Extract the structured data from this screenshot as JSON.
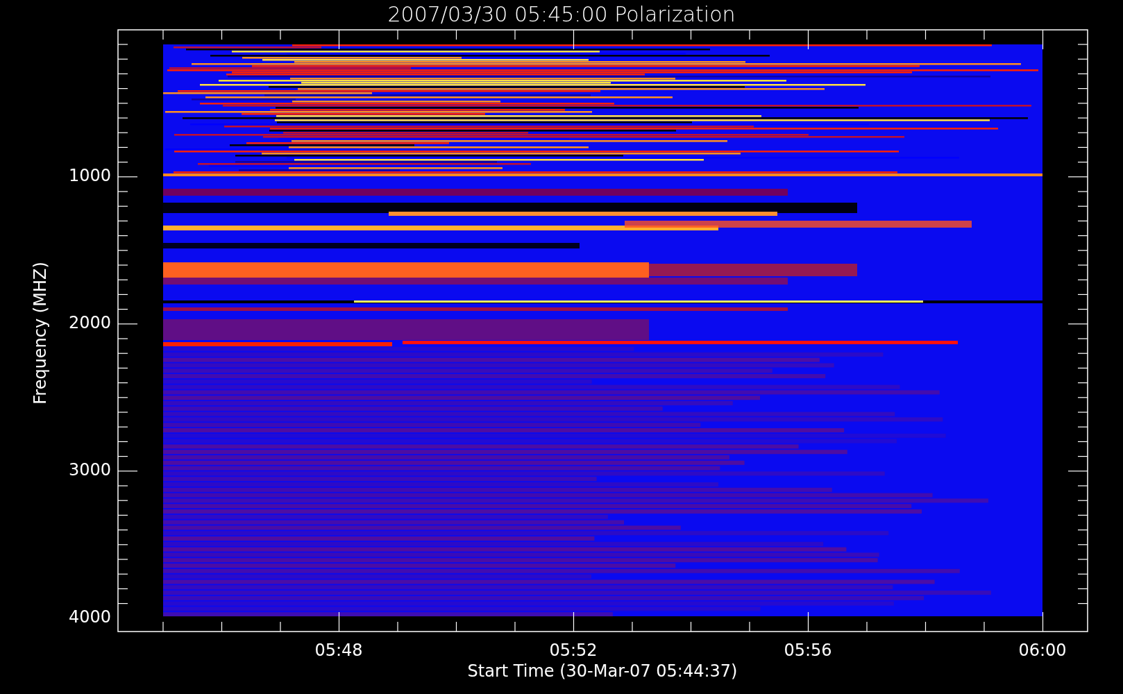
{
  "title": "2007/03/30 05:45:00 Polarization",
  "y_axis": {
    "label": "Frequency (MHZ)",
    "ticks": [
      "1000",
      "2000",
      "3000",
      "4000"
    ]
  },
  "x_axis": {
    "label": "Start Time (30-Mar-07 05:44:37)",
    "ticks": [
      "05:48",
      "05:52",
      "05:56",
      "06:00"
    ]
  }
}
